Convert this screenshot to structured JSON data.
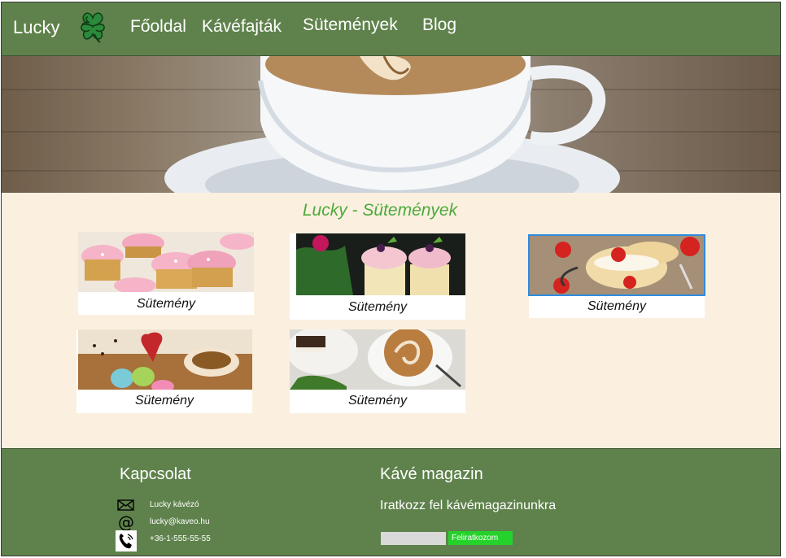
{
  "header": {
    "brand": "Lucky",
    "nav": [
      "Főoldal",
      "Kávéfajták",
      "Sütemények",
      "Blog"
    ]
  },
  "main": {
    "title": "Lucky - Sütemények",
    "cards": [
      {
        "label": "Sütemény",
        "image": "pink frosted cupcakes"
      },
      {
        "label": "Sütemény",
        "image": "berry cupcakes with mint"
      },
      {
        "label": "Sütemény",
        "image": "strawberry cream puff pastries"
      },
      {
        "label": "Sütemény",
        "image": "heart mug with macarons"
      },
      {
        "label": "Sütemény",
        "image": "latte art coffee with cake"
      }
    ]
  },
  "footer": {
    "contact": {
      "heading": "Kapcsolat",
      "name": "Lucky kávézó",
      "email": "lucky@kaveo.hu",
      "phone": "+36-1-555-55-55"
    },
    "magazine": {
      "heading": "Kávé magazin",
      "text": "Iratkozz fel kávémagazinunkra",
      "email_placeholder": "",
      "button": "Feliratkozom"
    }
  },
  "colors": {
    "header_bg": "#5f824c",
    "main_bg": "#fbf0df",
    "title": "#4caa3c",
    "subscribe_button": "#25d22b",
    "selection": "#2f8be0"
  },
  "icons": [
    "clover-icon",
    "mail-icon",
    "at-icon",
    "phone-icon"
  ]
}
